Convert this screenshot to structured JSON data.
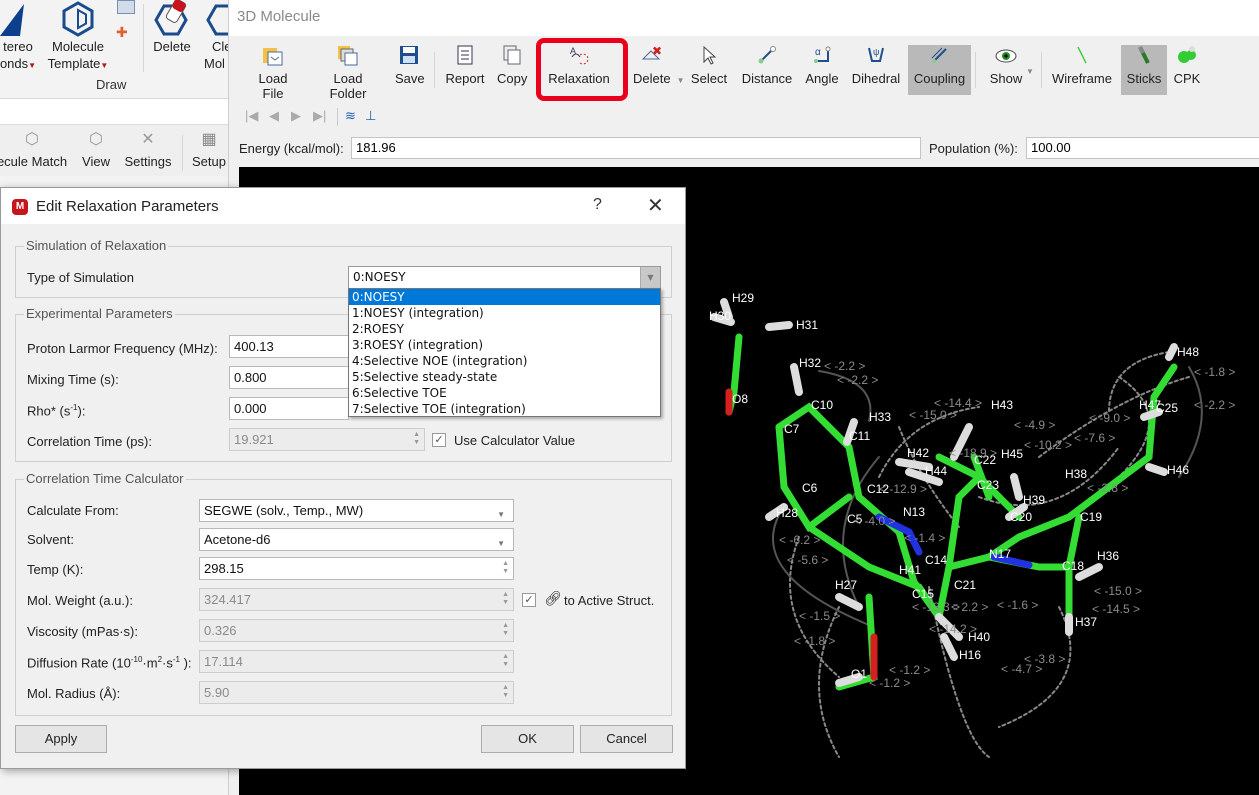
{
  "left_ribbon": {
    "buttons": [
      {
        "label_line1": "tereo",
        "label_line2": "onds",
        "icon": "stereo-bonds-icon"
      },
      {
        "label_line1": "Molecule",
        "label_line2": "Template",
        "icon": "benzene-icon"
      },
      {
        "label_line1": "Delete",
        "label_line2": "",
        "icon": "eraser-icon"
      },
      {
        "label_line1": "Cle",
        "label_line2": "Mol",
        "icon": "clear-molecule-icon"
      }
    ],
    "group_label": "Draw",
    "bottom_buttons": [
      {
        "label": "ecule Match",
        "icon": "molecule-match-icon"
      },
      {
        "label": "View",
        "icon": "view-icon"
      },
      {
        "label": "Settings",
        "icon": "settings-tools-icon"
      },
      {
        "label": "Setup",
        "icon": "setup-grid-icon"
      }
    ]
  },
  "main": {
    "title": "3D Molecule",
    "toolbar": [
      {
        "id": "load-file",
        "label": "Load File",
        "icon": "folder-open-icon"
      },
      {
        "id": "load-folder",
        "label": "Load Folder",
        "icon": "folders-icon"
      },
      {
        "id": "save",
        "label": "Save",
        "icon": "floppy-disk-icon"
      },
      {
        "id": "report",
        "label": "Report",
        "icon": "report-icon"
      },
      {
        "id": "copy",
        "label": "Copy",
        "icon": "copy-icon"
      },
      {
        "id": "relaxation",
        "label": "Relaxation",
        "icon": "relaxation-icon"
      },
      {
        "id": "delete",
        "label": "Delete",
        "icon": "delete-icon"
      },
      {
        "id": "select",
        "label": "Select",
        "icon": "cursor-icon"
      },
      {
        "id": "distance",
        "label": "Distance",
        "icon": "distance-icon"
      },
      {
        "id": "angle",
        "label": "Angle",
        "icon": "angle-icon"
      },
      {
        "id": "dihedral",
        "label": "Dihedral",
        "icon": "dihedral-icon"
      },
      {
        "id": "coupling",
        "label": "Coupling",
        "icon": "coupling-icon",
        "active": true
      },
      {
        "id": "show",
        "label": "Show",
        "icon": "eye-icon"
      },
      {
        "id": "wireframe",
        "label": "Wireframe",
        "icon": "wireframe-icon"
      },
      {
        "id": "sticks",
        "label": "Sticks",
        "icon": "sticks-icon",
        "active": true
      },
      {
        "id": "cpk",
        "label": "CPK",
        "icon": "cpk-icon"
      }
    ],
    "energy_label": "Energy (kcal/mol):",
    "energy_value": "181.96",
    "population_label": "Population (%):",
    "population_value": "100.00"
  },
  "dialog": {
    "title": "Edit Relaxation Parameters",
    "help": "?",
    "close": "✕",
    "simulation_group": "Simulation of Relaxation",
    "type_label": "Type of Simulation",
    "type_value": "0:NOESY",
    "type_options": [
      "0:NOESY",
      "1:NOESY (integration)",
      "2:ROESY",
      "3:ROESY (integration)",
      "4:Selective NOE (integration)",
      "5:Selective steady-state",
      "6:Selective TOE",
      "7:Selective TOE (integration)"
    ],
    "experimental_group": "Experimental Parameters",
    "larmor_label": "Proton Larmor Frequency (MHz):",
    "larmor_value": "400.13",
    "mixing_label": "Mixing Time (s):",
    "mixing_value": "0.800",
    "rho_label": "Rho* (s",
    "rho_sup": "-1",
    "rho_suffix": "):",
    "rho_value": "0.000",
    "corr_label": "Correlation Time (ps):",
    "corr_value": "19.921",
    "use_calc_label": "Use Calculator Value",
    "use_calc_checked": true,
    "calculator_group": "Correlation Time Calculator",
    "calc_from_label": "Calculate From:",
    "calc_from_value": "SEGWE (solv., Temp., MW)",
    "solvent_label": "Solvent:",
    "solvent_value": "Acetone-d6",
    "temp_label": "Temp (K):",
    "temp_value": "298.15",
    "molweight_label": "Mol. Weight (a.u.):",
    "molweight_value": "324.417",
    "link_label": "to Active Struct.",
    "link_checked": true,
    "viscosity_label": "Viscosity (mPas·s):",
    "viscosity_value": "0.326",
    "diffusion_label_a": "Diffusion Rate (10",
    "diffusion_sup1": "-10",
    "diffusion_label_b": "·m",
    "diffusion_sup2": "2",
    "diffusion_label_c": "·s",
    "diffusion_sup3": "-1",
    "diffusion_label_d": " ):",
    "diffusion_value": "17.114",
    "radius_label": "Mol. Radius (Å):",
    "radius_value": "5.90",
    "apply_label": "Apply",
    "ok_label": "OK",
    "cancel_label": "Cancel"
  },
  "molecule": {
    "atom_labels": [
      "H29",
      "H30",
      "H31",
      "H32",
      "O8",
      "C10",
      "H33",
      "C7",
      "C11",
      "C6",
      "C12",
      "H28",
      "C5",
      "N13",
      "C14",
      "H27",
      "H41",
      "C21",
      "N17",
      "C15",
      "H40",
      "H16",
      "O1",
      "C20",
      "H39",
      "C19",
      "H36",
      "C18",
      "H37",
      "H38",
      "H42",
      "H44",
      "C22",
      "H45",
      "H43",
      "C23",
      "C25",
      "H48",
      "H46",
      "H47"
    ],
    "coupling_labels": [
      "< -2.2 >",
      "< -2.2 >",
      "< -15.0 >",
      "< -14.4 >",
      "< -18.9 >",
      "< -10.2 >",
      "< -4.9 >",
      "< -9.0 >",
      "< -7.6 >",
      "< -1.8 >",
      "< -2.2 >",
      "< -6.2 >",
      "< -5.6 >",
      "< -4.0 >",
      "< -1.4 >",
      "< -1.5 >",
      "< -1.8 >",
      "< -1.2 >",
      "< -1.2 >",
      "< -13.3 >",
      "< -14.2 >",
      "< -1.6 >",
      "< -15.0 >",
      "< -14.5 >",
      "< -3.8 >",
      "< -4.7 >",
      "< 2.2 >",
      "< -2.8 >",
      "< -12.9 >"
    ]
  }
}
